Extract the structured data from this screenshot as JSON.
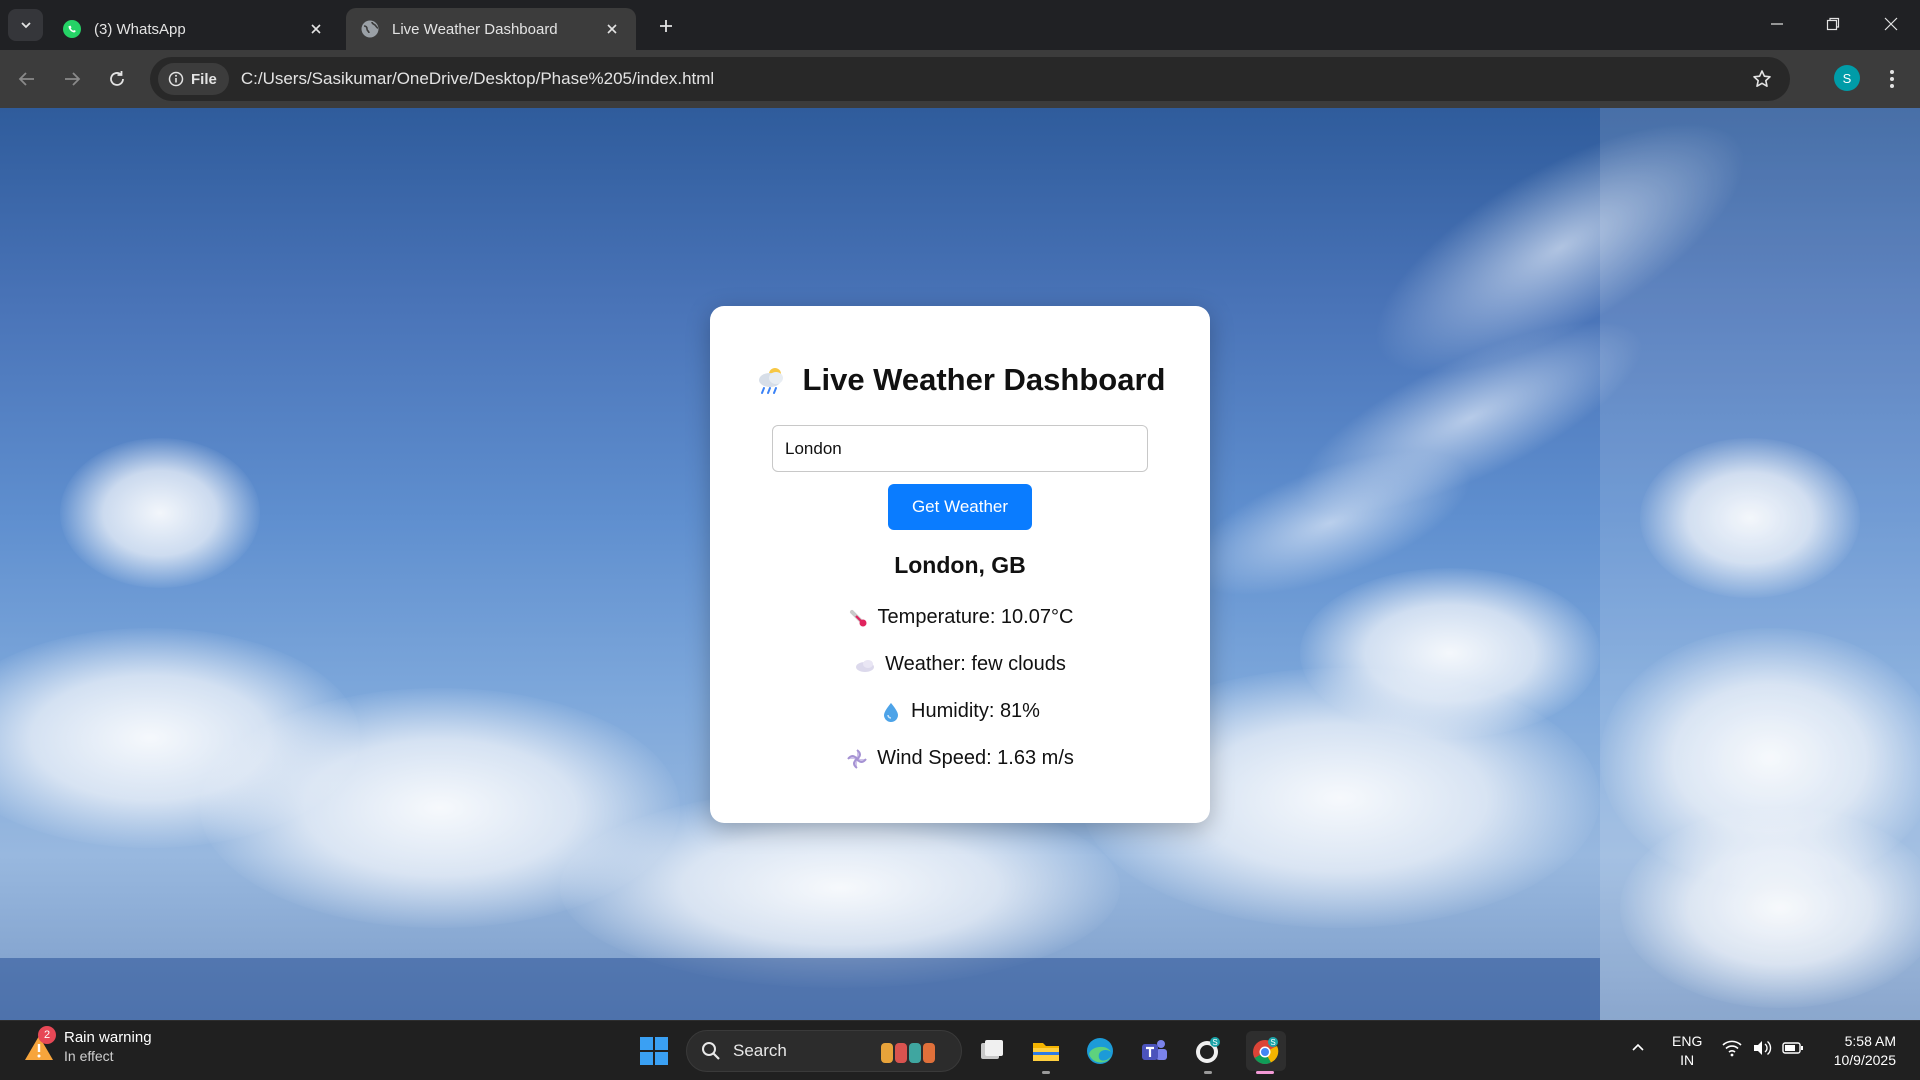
{
  "browser": {
    "tabs": [
      {
        "title": "(3) WhatsApp",
        "favicon": "whatsapp-icon",
        "active": false
      },
      {
        "title": "Live Weather Dashboard",
        "favicon": "globe-icon",
        "active": true
      }
    ],
    "address": {
      "chip_label": "File",
      "url": "C:/Users/Sasikumar/OneDrive/Desktop/Phase%205/index.html"
    },
    "profile_initial": "S"
  },
  "app": {
    "title": "Live Weather Dashboard",
    "title_icon": "cloud-rain-icon",
    "search": {
      "value": "London"
    },
    "button_label": "Get Weather",
    "location": "London, GB",
    "stats": {
      "temperature": "Temperature: 10.07°C",
      "weather": "Weather: few clouds",
      "humidity": "Humidity: 81%",
      "wind": "Wind Speed: 1.63 m/s"
    },
    "colors": {
      "button": "#0a7cff",
      "card": "#ffffff"
    }
  },
  "taskbar": {
    "widget": {
      "title": "Rain warning",
      "subtitle": "In effect",
      "badge": "2"
    },
    "search_label": "Search",
    "language": {
      "line1": "ENG",
      "line2": "IN"
    },
    "clock": {
      "time": "5:58 AM",
      "date": "10/9/2025"
    },
    "notification_badge": "S"
  }
}
